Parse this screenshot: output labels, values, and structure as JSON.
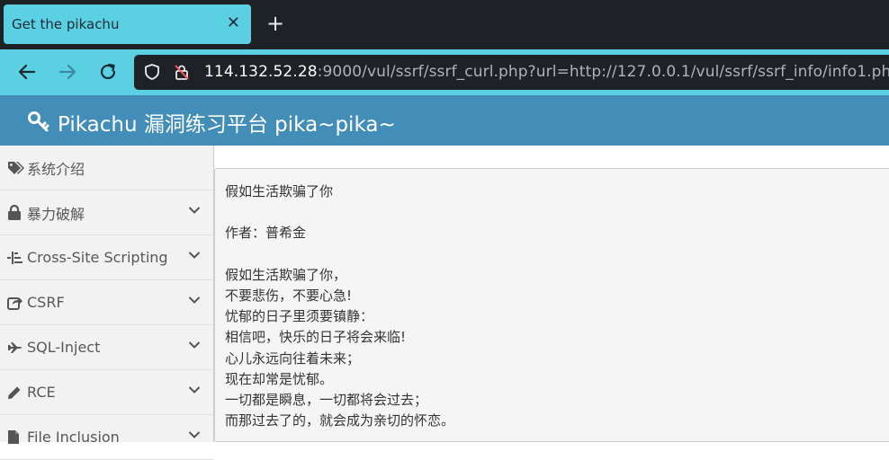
{
  "browser": {
    "tab_title": "Get the pikachu",
    "tab_close": "✕",
    "new_tab": "+",
    "url_host": "114.132.52.28",
    "url_rest": ":9000/vul/ssrf/ssrf_curl.php?url=http://127.0.0.1/vul/ssrf/ssrf_info/info1.php"
  },
  "header": {
    "title": "Pikachu 漏洞练习平台 pika~pika~"
  },
  "sidebar": {
    "items": [
      {
        "label": "系统介绍",
        "icon": "tags-icon",
        "has_chevron": false
      },
      {
        "label": "暴力破解",
        "icon": "lock-icon",
        "has_chevron": true
      },
      {
        "label": "Cross-Site Scripting",
        "icon": "list-icon",
        "has_chevron": true
      },
      {
        "label": "CSRF",
        "icon": "share-icon",
        "has_chevron": true
      },
      {
        "label": "SQL-Inject",
        "icon": "plane-icon",
        "has_chevron": true
      },
      {
        "label": "RCE",
        "icon": "pencil-icon",
        "has_chevron": true
      },
      {
        "label": "File Inclusion",
        "icon": "file-icon",
        "has_chevron": true
      }
    ]
  },
  "poem": {
    "title": "假如生活欺骗了你",
    "author": "作者：普希金",
    "lines": [
      "假如生活欺骗了你，",
      "不要悲伤，不要心急!",
      "忧郁的日子里须要镇静：",
      "相信吧，快乐的日子将会来临!",
      "心儿永远向往着未来；",
      "现在却常是忧郁。",
      "一切都是瞬息，一切都将会过去；",
      "而那过去了的，就会成为亲切的怀恋。"
    ]
  },
  "colors": {
    "tab_accent": "#5bd0e3",
    "header_blue": "#438eb9",
    "dark_chrome": "#1e2126"
  }
}
